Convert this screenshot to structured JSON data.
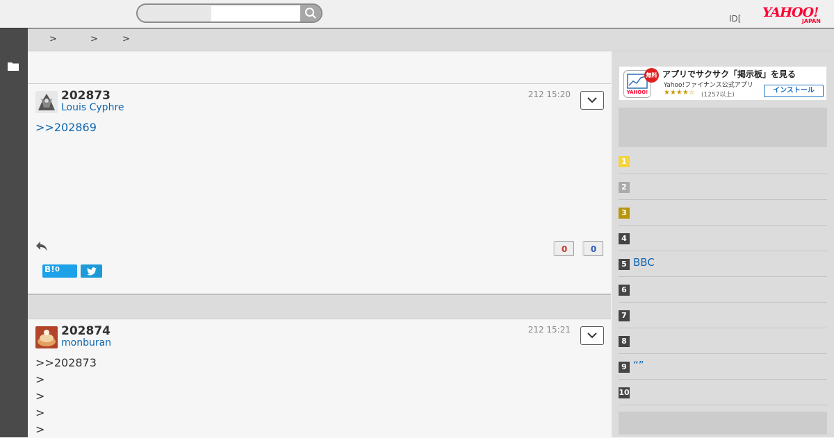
{
  "header": {
    "search_placeholder": "",
    "id_link": "ID[",
    "logo_text": "YAHOO!",
    "logo_sub": "JAPAN"
  },
  "breadcrumb": {
    "sep1": ">",
    "sep2": ">",
    "sep3": ">"
  },
  "posts": [
    {
      "number": "202873",
      "author": "Louis Cyphre",
      "time": "212 15:20",
      "quote": ">>202869",
      "likes": "0",
      "dislikes": "0",
      "hatena_label": "B!",
      "hatena_count": "0"
    },
    {
      "number": "202874",
      "author": "monburan",
      "time": "212 15:21",
      "lines": [
        ">>202873",
        ">",
        ">",
        ">",
        ">"
      ]
    }
  ],
  "sidebar": {
    "app": {
      "title": "アプリでサクサク「掲示板」を見る",
      "subtitle": "Yahoo!ファイナンス公式アプリ",
      "stars": "★★★★☆",
      "count": "(1257以上)",
      "free_badge": "無料",
      "install": "インストール"
    },
    "ranking": [
      {
        "rank": "1",
        "title": "",
        "color": "#f5d33b"
      },
      {
        "rank": "2",
        "title": "",
        "color": "#aaaaaa"
      },
      {
        "rank": "3",
        "title": "",
        "color": "#b8960b"
      },
      {
        "rank": "4",
        "title": "",
        "color": "#444444"
      },
      {
        "rank": "5",
        "title": "BBC",
        "color": "#444444"
      },
      {
        "rank": "6",
        "title": "",
        "color": "#444444"
      },
      {
        "rank": "7",
        "title": "",
        "color": "#444444"
      },
      {
        "rank": "8",
        "title": "",
        "color": "#444444"
      },
      {
        "rank": "9",
        "title": "“”",
        "color": "#444444"
      },
      {
        "rank": "10",
        "title": "",
        "color": "#444444"
      }
    ]
  },
  "colors": {
    "link": "#0f66b0",
    "like": "#c0392b",
    "dislike": "#2d5bb8",
    "accent": "#ff0033"
  }
}
